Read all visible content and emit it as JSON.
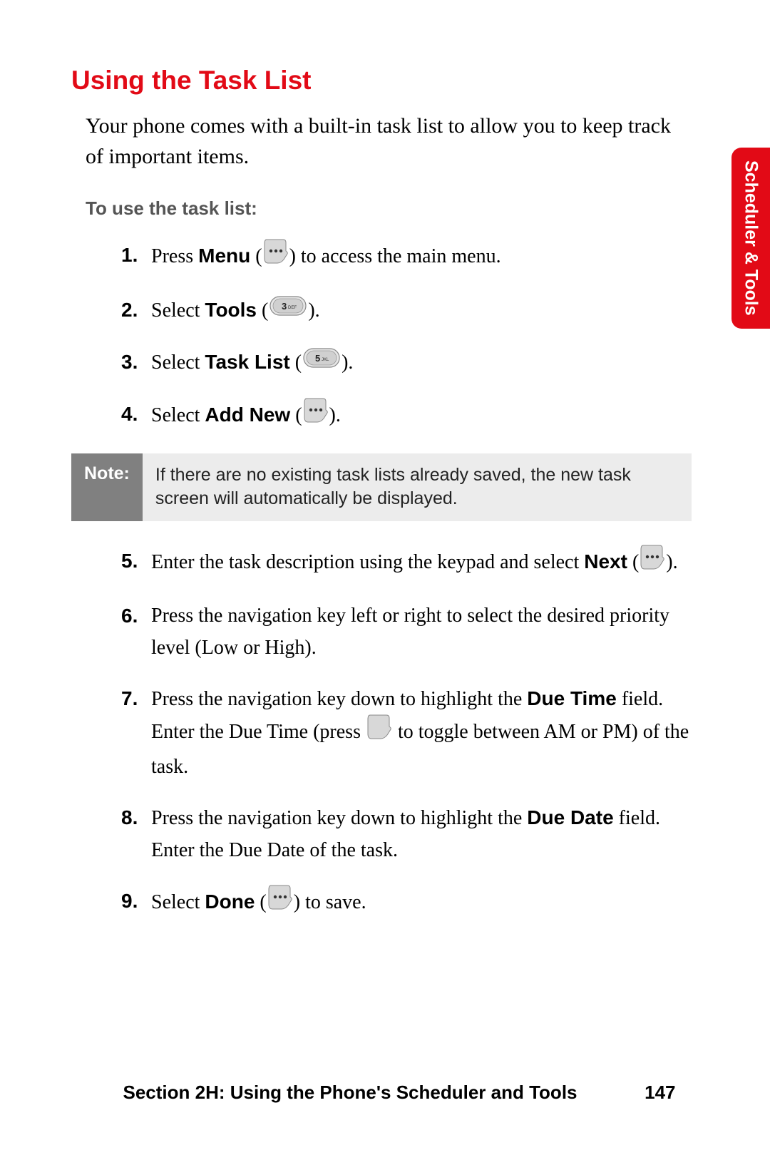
{
  "heading": "Using the Task List",
  "intro": "Your phone comes with a built-in task list to allow you to keep track of important items.",
  "subheading": "To use the task list:",
  "steps": {
    "s1": {
      "num": "1.",
      "a": "Press ",
      "b": "Menu",
      "c": " (",
      "d": ") to access the main menu."
    },
    "s2": {
      "num": "2.",
      "a": "Select ",
      "b": "Tools",
      "c": " (",
      "d": ")."
    },
    "s3": {
      "num": "3.",
      "a": "Select ",
      "b": "Task List",
      "c": " (",
      "d": ")."
    },
    "s4": {
      "num": "4.",
      "a": "Select ",
      "b": "Add New",
      "c": " (",
      "d": ")."
    },
    "s5": {
      "num": "5.",
      "a": "Enter the task description using the keypad and select ",
      "b": "Next",
      "c": " (",
      "d": ")."
    },
    "s6": {
      "num": "6.",
      "a": "Press the navigation key left or right to select the desired priority level (Low or High)."
    },
    "s7": {
      "num": "7.",
      "a": "Press the navigation key down to highlight the ",
      "b": "Due Time",
      "c": " field. Enter the Due Time (press ",
      "d": " to toggle between AM or PM) of the task."
    },
    "s8": {
      "num": "8.",
      "a": "Press the navigation key down to highlight the ",
      "b": "Due Date",
      "c": " field. Enter the Due Date of the task."
    },
    "s9": {
      "num": "9.",
      "a": "Select ",
      "b": "Done",
      "c": " (",
      "d": ") to save."
    }
  },
  "note": {
    "label": "Note:",
    "text": "If there are no existing task lists already saved, the new task screen will automatically be displayed."
  },
  "keycaps": {
    "three": "3 DEF",
    "five": "5 JKL"
  },
  "side_tab": "Scheduler & Tools",
  "footer": {
    "section": "Section 2H: Using the Phone's Scheduler and Tools",
    "page": "147"
  }
}
